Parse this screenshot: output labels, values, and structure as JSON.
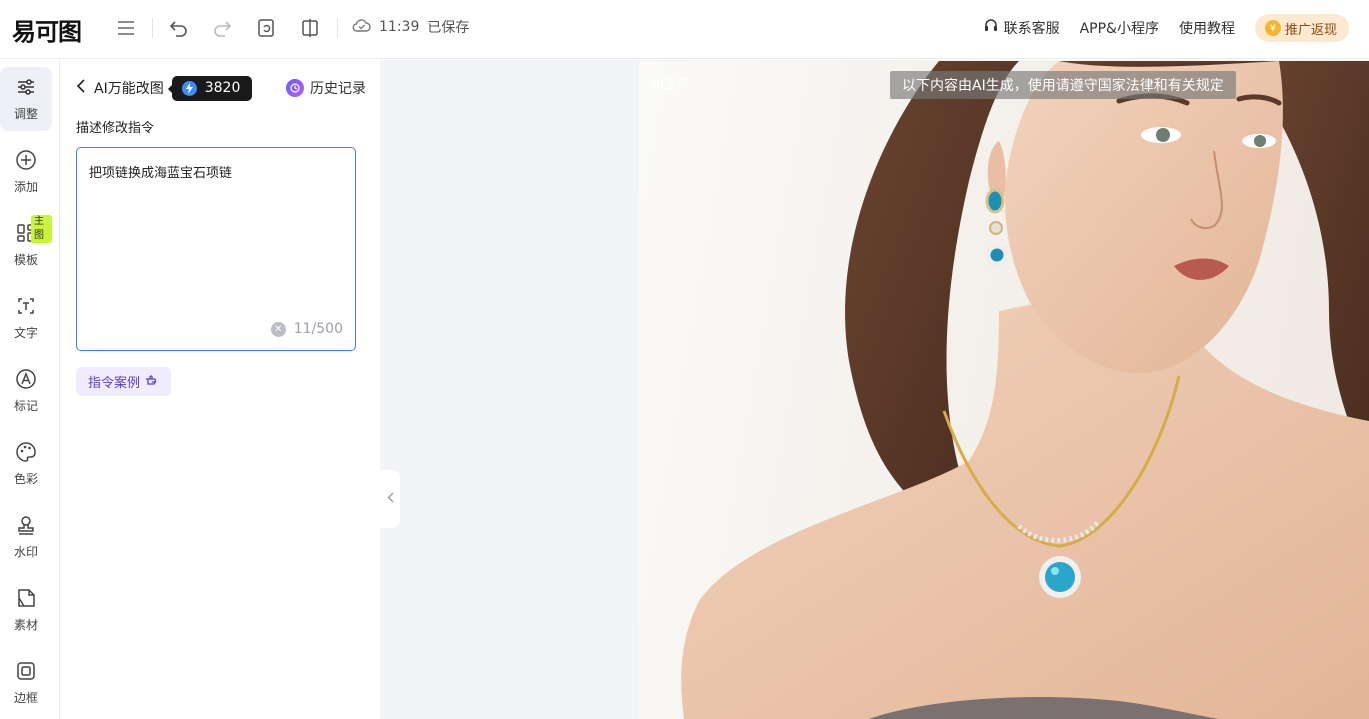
{
  "app": {
    "logo": "易可图",
    "save_time": "11:39",
    "save_status": "已保存"
  },
  "header": {
    "links": [
      {
        "label": "联系客服",
        "icon": "headset-icon"
      },
      {
        "label": "APP&小程序",
        "icon": ""
      },
      {
        "label": "使用教程",
        "icon": ""
      }
    ],
    "promo_label": "推广返现"
  },
  "rail": {
    "items": [
      {
        "label": "调整",
        "icon": "sliders-icon",
        "active": true
      },
      {
        "label": "添加",
        "icon": "plus-circle-icon"
      },
      {
        "label": "模板",
        "icon": "grid-icon",
        "badge": "主图"
      },
      {
        "label": "文字",
        "icon": "text-icon"
      },
      {
        "label": "标记",
        "icon": "marker-icon"
      },
      {
        "label": "色彩",
        "icon": "palette-icon"
      },
      {
        "label": "水印",
        "icon": "stamp-icon"
      },
      {
        "label": "素材",
        "icon": "material-icon"
      },
      {
        "label": "边框",
        "icon": "frame-icon"
      }
    ]
  },
  "panel": {
    "title": "AI万能改图",
    "credits": "3820",
    "history_label": "历史记录",
    "desc_label": "描述修改指令",
    "prompt_value": "把项链换成海蓝宝石项链",
    "char_count": "11/500",
    "example_label": "指令案例"
  },
  "canvas": {
    "watermark": "AI生成",
    "notice": "以下内容由AI生成，使用请遵守国家法律和有关规定"
  },
  "colors": {
    "accent_blue": "#3c7df0",
    "promo_bg": "#fde9d0",
    "badge_green": "#c8f53b",
    "example_purple": "#5a3cc8"
  }
}
